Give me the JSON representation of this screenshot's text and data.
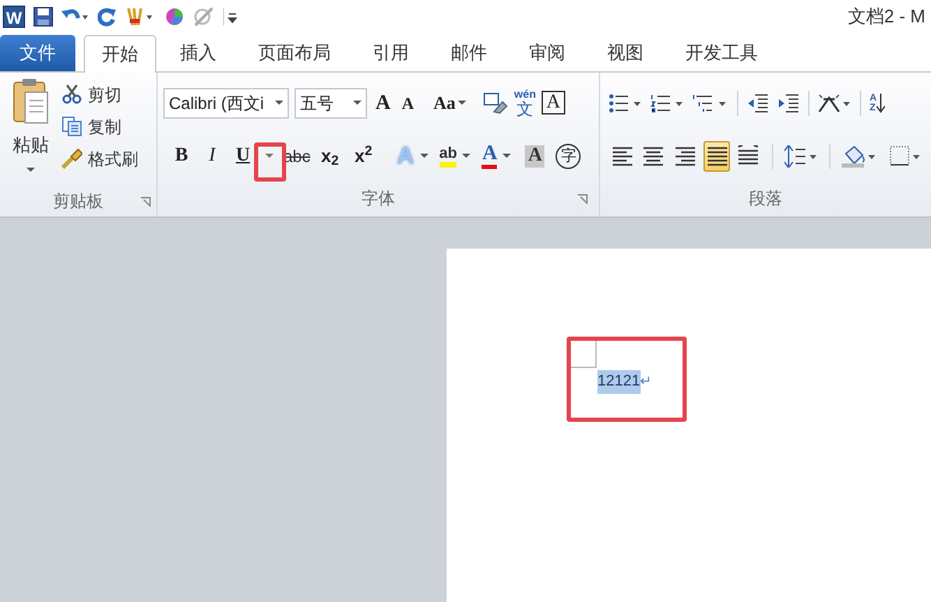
{
  "quick_access": {
    "app_logo": "W"
  },
  "window": {
    "title": "文档2 - M"
  },
  "tabs": [
    {
      "label": "文件",
      "kind": "file",
      "selected": false
    },
    {
      "label": "开始",
      "kind": "tab",
      "selected": true
    },
    {
      "label": "插入",
      "kind": "tab",
      "selected": false
    },
    {
      "label": "页面布局",
      "kind": "tab",
      "selected": false
    },
    {
      "label": "引用",
      "kind": "tab",
      "selected": false
    },
    {
      "label": "邮件",
      "kind": "tab",
      "selected": false
    },
    {
      "label": "审阅",
      "kind": "tab",
      "selected": false
    },
    {
      "label": "视图",
      "kind": "tab",
      "selected": false
    },
    {
      "label": "开发工具",
      "kind": "tab",
      "selected": false
    }
  ],
  "clipboard": {
    "paste": "粘贴",
    "items": [
      "剪切",
      "复制",
      "格式刷"
    ],
    "label": "剪贴板"
  },
  "font": {
    "row_1": [
      {
        "kind": "field",
        "text": "Calibri (西文i"
      },
      {
        "kind": "field",
        "text": "五号"
      },
      {
        "kind": "grow",
        "text": "A"
      },
      {
        "kind": "shrink",
        "text": "A"
      },
      {
        "kind": "case",
        "text": "Aa"
      },
      {
        "kind": "clear"
      },
      {
        "kind": "phonetic",
        "text": "wén",
        "sub": "文"
      },
      {
        "kind": "border",
        "text": "A"
      }
    ],
    "row_2": [
      {
        "kind": "bold",
        "text": "B"
      },
      {
        "kind": "italic",
        "text": "I"
      },
      {
        "kind": "underline",
        "text": "U"
      },
      {
        "kind": "dropdown"
      },
      {
        "kind": "strike",
        "text": "abc"
      },
      {
        "kind": "script",
        "text": "x$_{2}$"
      },
      {
        "kind": "script",
        "text": "x$^{2}$"
      },
      {
        "kind": "effect",
        "text": "A"
      },
      {
        "kind": "highlight",
        "text": "ab"
      },
      {
        "kind": "color",
        "text": "A"
      },
      {
        "kind": "shade",
        "text": "A"
      },
      {
        "kind": "enclose",
        "text": "字"
      }
    ],
    "label": "字体"
  },
  "paragraph": {
    "sort": "AZ",
    "alignments": [
      {
        "selected": false
      },
      {
        "selected": false
      },
      {
        "selected": false
      },
      {
        "selected": true
      },
      {
        "selected": false
      }
    ],
    "label": "段落"
  },
  "document": {
    "text": "12121",
    "selected": true,
    "mark": "↵"
  }
}
